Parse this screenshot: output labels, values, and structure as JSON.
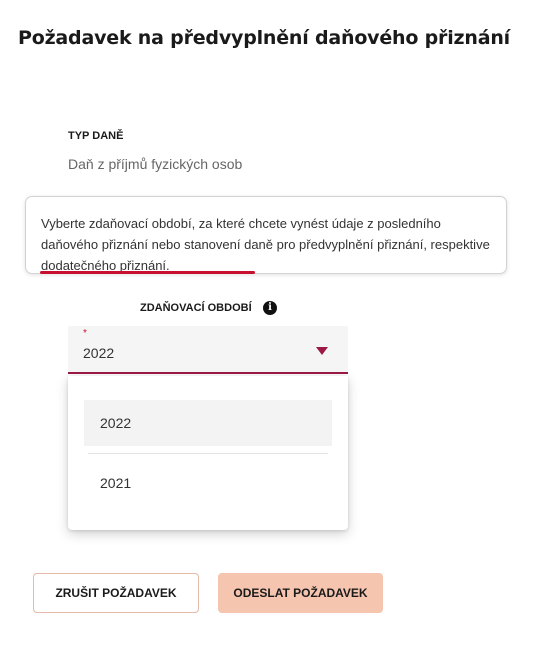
{
  "page": {
    "title": "Požadavek na předvyplnění daňového přiznání"
  },
  "tax_type": {
    "label": "TYP DANĚ",
    "value": "Daň z příjmů fyzických osob"
  },
  "tooltip": {
    "text": "Vyberte zdaňovací období, za které chcete vynést údaje z posledního daňového přiznání nebo stanovení daně pro předvyplnění přiznání, respektive dodatečného přiznání.",
    "accent_color": "#c8102e"
  },
  "period": {
    "label": "ZDAŇOVACÍ OBDOBÍ",
    "info_icon": "info-icon",
    "required_mark": "*",
    "selected": "2022",
    "options": [
      "2022",
      "2021"
    ],
    "accent_color": "#9b1a45"
  },
  "actions": {
    "cancel_label": "ZRUŠIT POŽADAVEK",
    "submit_label": "ODESLAT POŽADAVEK"
  }
}
